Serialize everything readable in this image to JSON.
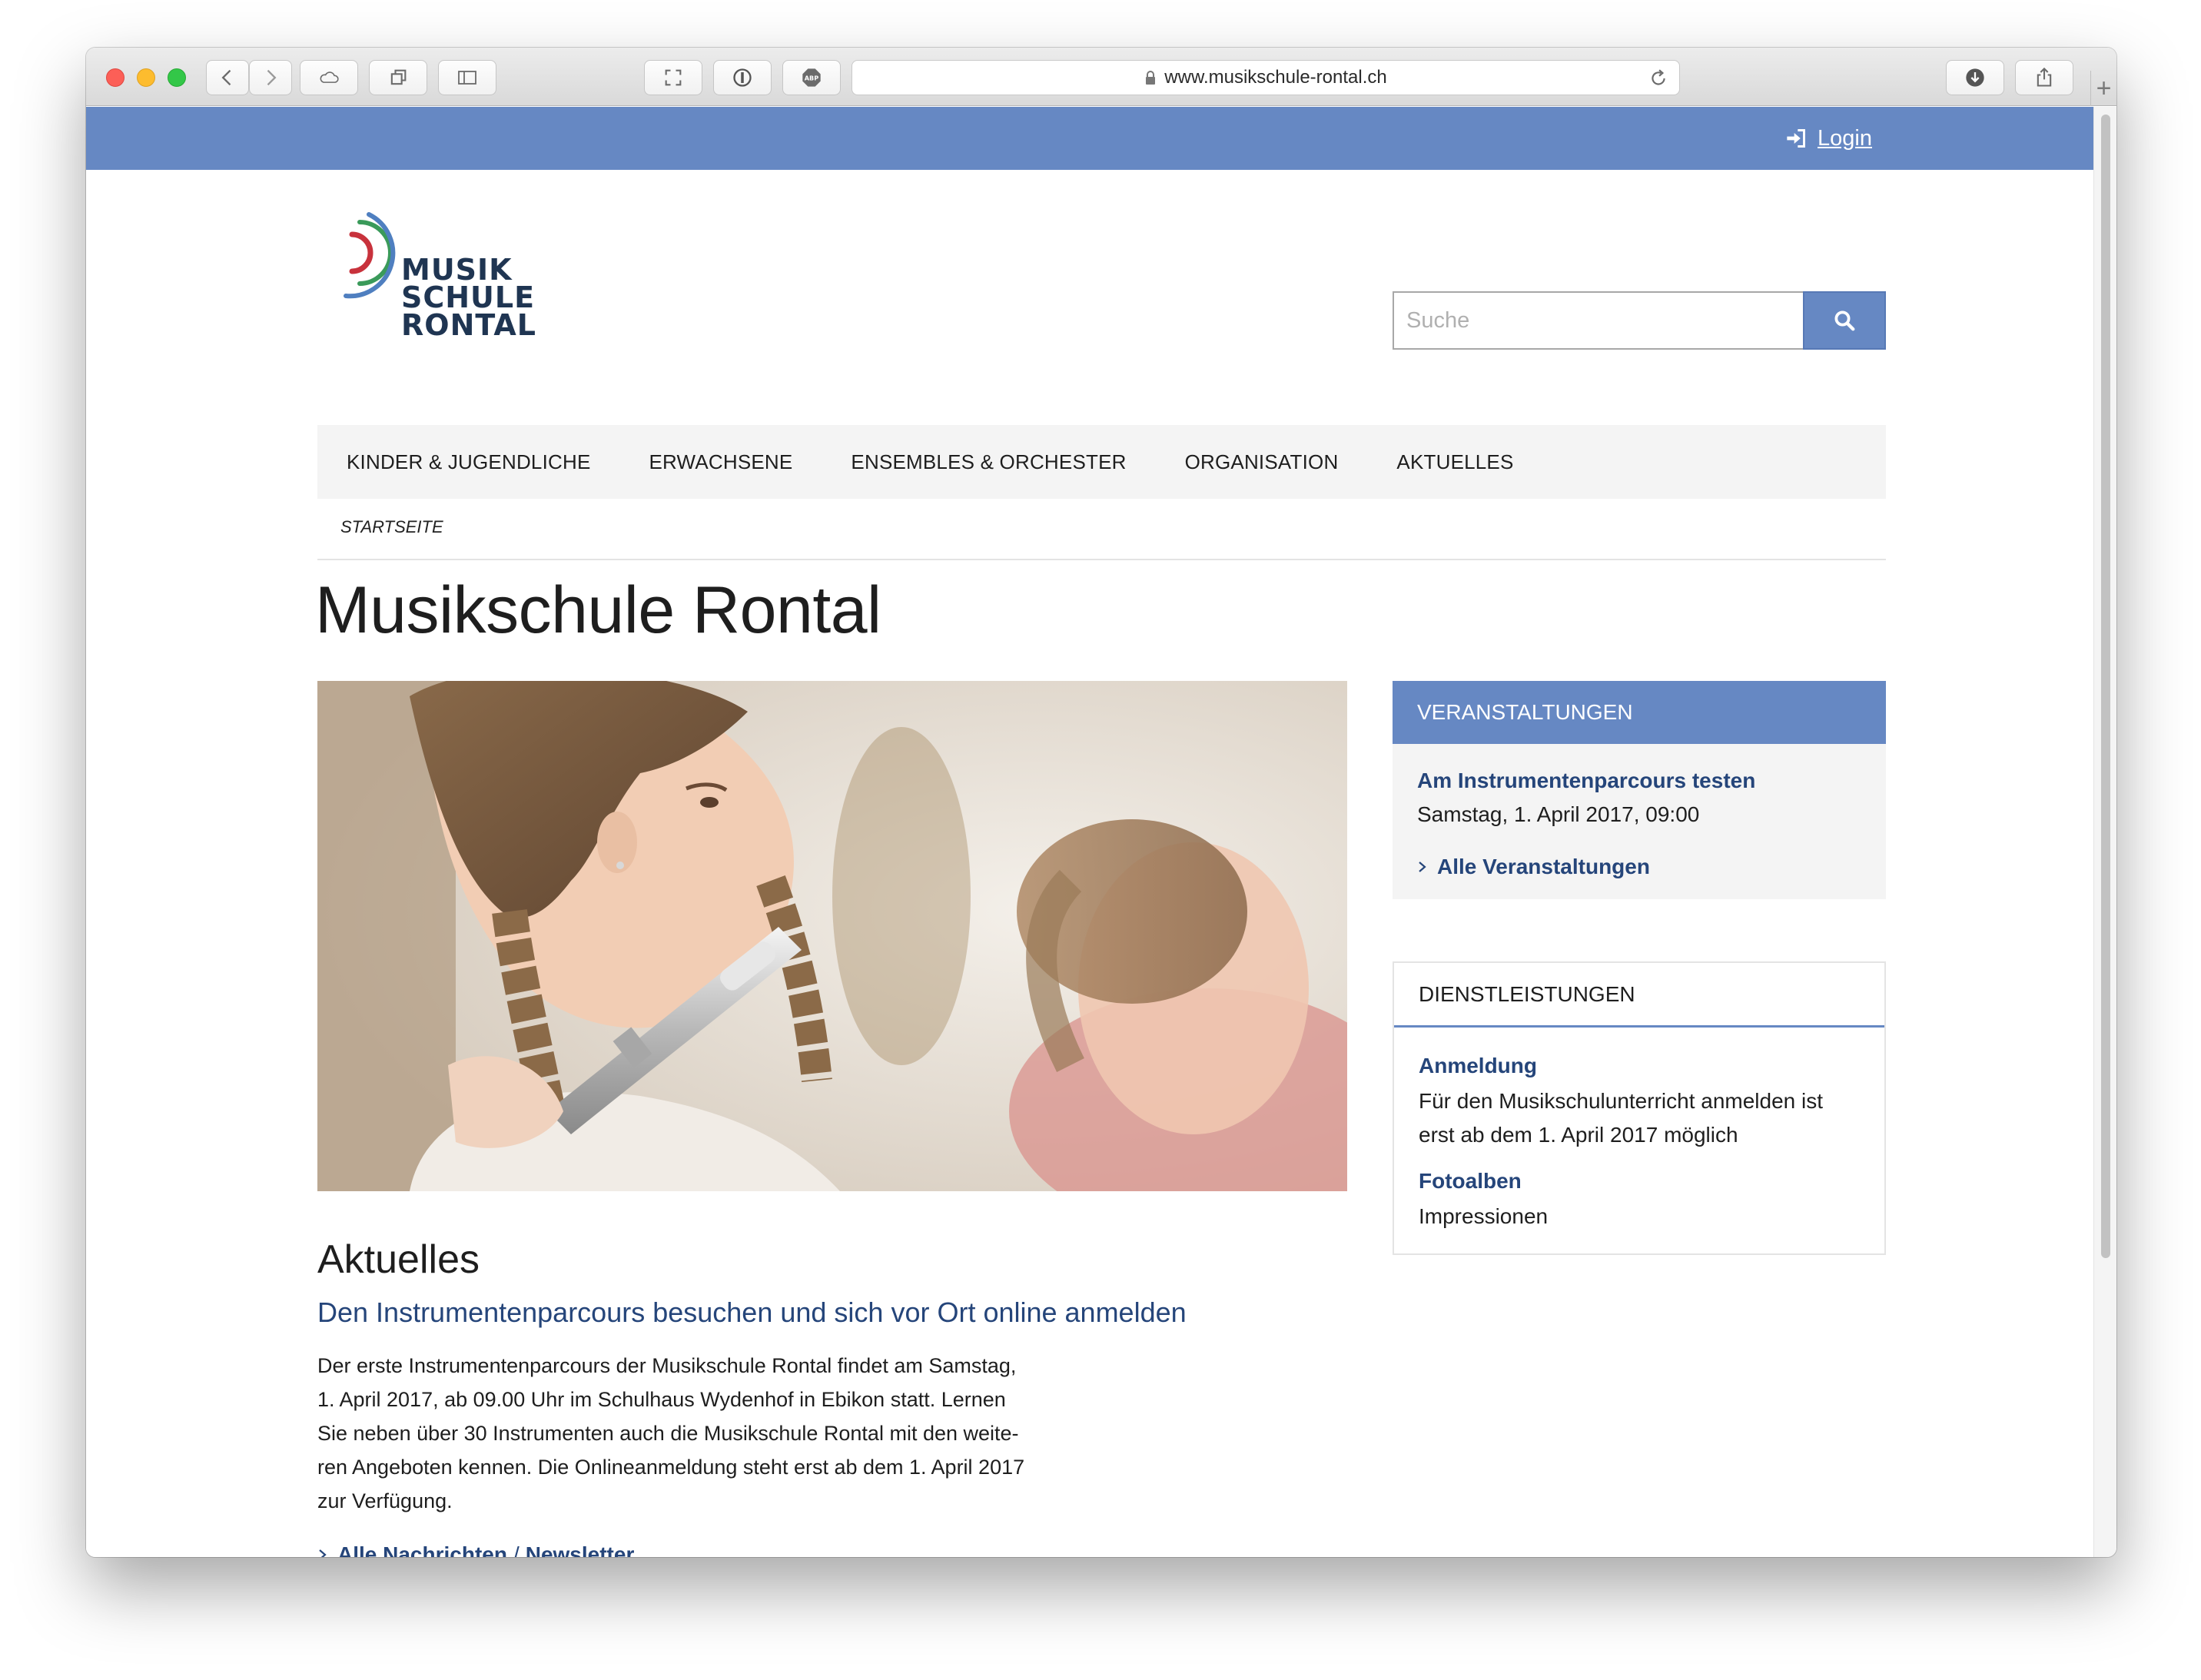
{
  "browser": {
    "url": "www.musikschule-rontal.ch"
  },
  "header": {
    "login_label": "Login",
    "logo_lines": [
      "MUSIK",
      "SCHULE",
      "RONTAL"
    ],
    "search_placeholder": "Suche"
  },
  "nav": {
    "items": [
      {
        "label": "KINDER & JUGENDLICHE"
      },
      {
        "label": "ERWACHSENE"
      },
      {
        "label": "ENSEMBLES & ORCHESTER"
      },
      {
        "label": "ORGANISATION"
      },
      {
        "label": "AKTUELLES"
      }
    ]
  },
  "breadcrumb": "STARTSEITE",
  "page_title": "Musikschule Rontal",
  "news": {
    "heading": "Aktuelles",
    "title": "Den Instrumentenparcours besuchen und sich vor Ort online anmelden",
    "text_lines": [
      "Der erste Instrumentenparcours der Musikschule Rontal findet am Samstag,",
      "1. April 2017, ab 09.00 Uhr im Schulhaus Wydenhof in Ebikon statt. Lernen",
      "Sie neben über 30 Instrumenten auch die Musikschule Rontal mit den weite-",
      "ren Angeboten kennen. Die Onlineanmeldung steht erst ab dem 1. April 2017",
      "zur Verfügung."
    ],
    "link_all": "Alle Nachrichten",
    "separator": "/",
    "link_newsletter": "Newsletter"
  },
  "events": {
    "heading": "VERANSTALTUNGEN",
    "event_title": "Am Instrumentenparcours testen",
    "event_date": "Samstag, 1. April 2017, 09:00",
    "all_link": "Alle Veranstaltungen"
  },
  "services": {
    "heading": "DIENSTLEISTUNGEN",
    "items": [
      {
        "title": "Anmeldung",
        "text": "Für den Musikschulunterricht anmelden ist erst ab dem 1. April 2017 möglich"
      },
      {
        "title": "Fotoalben",
        "text": "Impressionen"
      }
    ]
  },
  "colors": {
    "brand_blue": "#6688c3",
    "link_blue": "#25457a",
    "logo_red": "#c8323c",
    "logo_green": "#3a9a5a",
    "logo_blue": "#4f7fc0",
    "logo_text": "#1f3552"
  },
  "icons": {
    "login": "sign-in-icon",
    "search": "search-icon",
    "chevron": "chevron-right-icon"
  }
}
